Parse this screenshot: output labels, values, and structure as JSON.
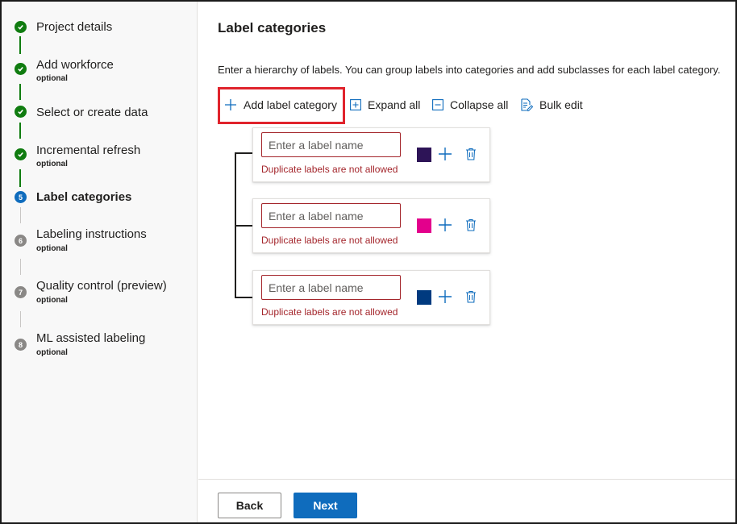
{
  "sidebar": {
    "steps": [
      {
        "title": "Project details",
        "subtitle": "",
        "state": "done",
        "icon": "check-icon"
      },
      {
        "title": "Add workforce",
        "subtitle": "optional",
        "state": "done",
        "icon": "check-icon"
      },
      {
        "title": "Select or create data",
        "subtitle": "",
        "state": "done",
        "icon": "check-icon"
      },
      {
        "title": "Incremental refresh",
        "subtitle": "optional",
        "state": "done",
        "icon": "check-icon"
      },
      {
        "title": "Label categories",
        "subtitle": "",
        "state": "current",
        "number": "5"
      },
      {
        "title": "Labeling instructions",
        "subtitle": "optional",
        "state": "todo",
        "number": "6"
      },
      {
        "title": "Quality control (preview)",
        "subtitle": "optional",
        "state": "todo",
        "number": "7"
      },
      {
        "title": "ML assisted labeling",
        "subtitle": "optional",
        "state": "todo",
        "number": "8"
      }
    ]
  },
  "main": {
    "title": "Label categories",
    "description": "Enter a hierarchy of labels. You can group labels into categories and add subclasses for each label category.",
    "toolbar": {
      "add_label_category": "Add label category",
      "expand_all": "Expand all",
      "collapse_all": "Collapse all",
      "bulk_edit": "Bulk edit"
    },
    "labels": [
      {
        "placeholder": "Enter a label name",
        "value": "",
        "error": "Duplicate labels are not allowed",
        "color": "#2d1457"
      },
      {
        "placeholder": "Enter a label name",
        "value": "",
        "error": "Duplicate labels are not allowed",
        "color": "#e3008c"
      },
      {
        "placeholder": "Enter a label name",
        "value": "",
        "error": "Duplicate labels are not allowed",
        "color": "#003a7f"
      }
    ]
  },
  "footer": {
    "back_label": "Back",
    "next_label": "Next"
  },
  "colors": {
    "accent": "#0f6cbd",
    "success": "#107c10",
    "error": "#a4262c",
    "highlight": "#e0232c"
  }
}
